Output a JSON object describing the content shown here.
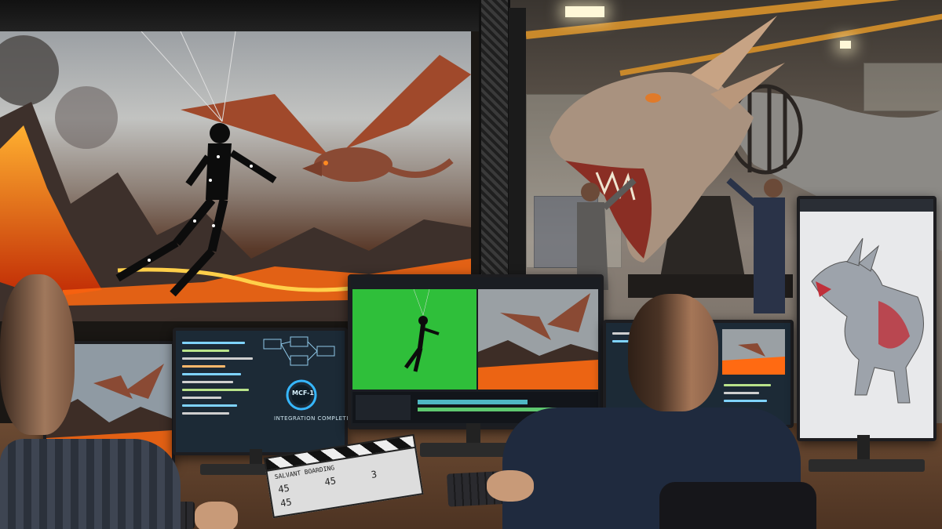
{
  "monitor_left_center": {
    "badge": "MCF-1",
    "status": "INTEGRATION COMPLETE"
  },
  "clapperboard": {
    "header": "SALVANT BOARDING",
    "row1": [
      "45",
      "45",
      "3"
    ],
    "row2": "45"
  },
  "colors": {
    "greenscreen": "#2fbf3a",
    "lava": "#ff6a12",
    "beam": "#c9892b",
    "screen_blue": "#1c2a36"
  }
}
